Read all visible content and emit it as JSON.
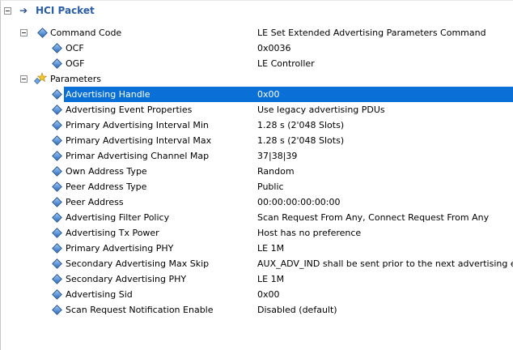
{
  "header": {
    "title": "HCI Packet"
  },
  "command_code": {
    "label": "Command Code",
    "value": "LE Set Extended Advertising Parameters Command",
    "children": [
      {
        "name": "OCF",
        "value": "0x0036"
      },
      {
        "name": "OGF",
        "value": "LE Controller"
      }
    ]
  },
  "parameters": {
    "label": "Parameters",
    "items": [
      {
        "name": "Advertising Handle",
        "value": "0x00"
      },
      {
        "name": "Advertising Event Properties",
        "value": "Use legacy advertising PDUs"
      },
      {
        "name": "Primary Advertising Interval Min",
        "value": "1.28 s (2'048 Slots)"
      },
      {
        "name": "Primary Advertising Interval Max",
        "value": "1.28 s (2'048 Slots)"
      },
      {
        "name": "Primar Advertising Channel Map",
        "value": "37|38|39"
      },
      {
        "name": "Own Address Type",
        "value": "Random"
      },
      {
        "name": "Peer Address Type",
        "value": "Public"
      },
      {
        "name": "Peer Address",
        "value": "00:00:00:00:00:00"
      },
      {
        "name": "Advertising Filter Policy",
        "value": "Scan Request From Any, Connect Request From Any"
      },
      {
        "name": "Advertising Tx Power",
        "value": "Host has no preference"
      },
      {
        "name": "Primary Advertising PHY",
        "value": "LE 1M"
      },
      {
        "name": "Secondary Advertising Max Skip",
        "value": "AUX_ADV_IND shall be sent prior to the next advertising event"
      },
      {
        "name": "Secondary Advertising PHY",
        "value": "LE 1M"
      },
      {
        "name": "Advertising Sid",
        "value": "0x00"
      },
      {
        "name": "Scan Request Notification Enable",
        "value": "Disabled (default)"
      }
    ],
    "selected_index": 0
  },
  "colors": {
    "selection": "#0a6fd6",
    "title": "#2a5ea8"
  }
}
